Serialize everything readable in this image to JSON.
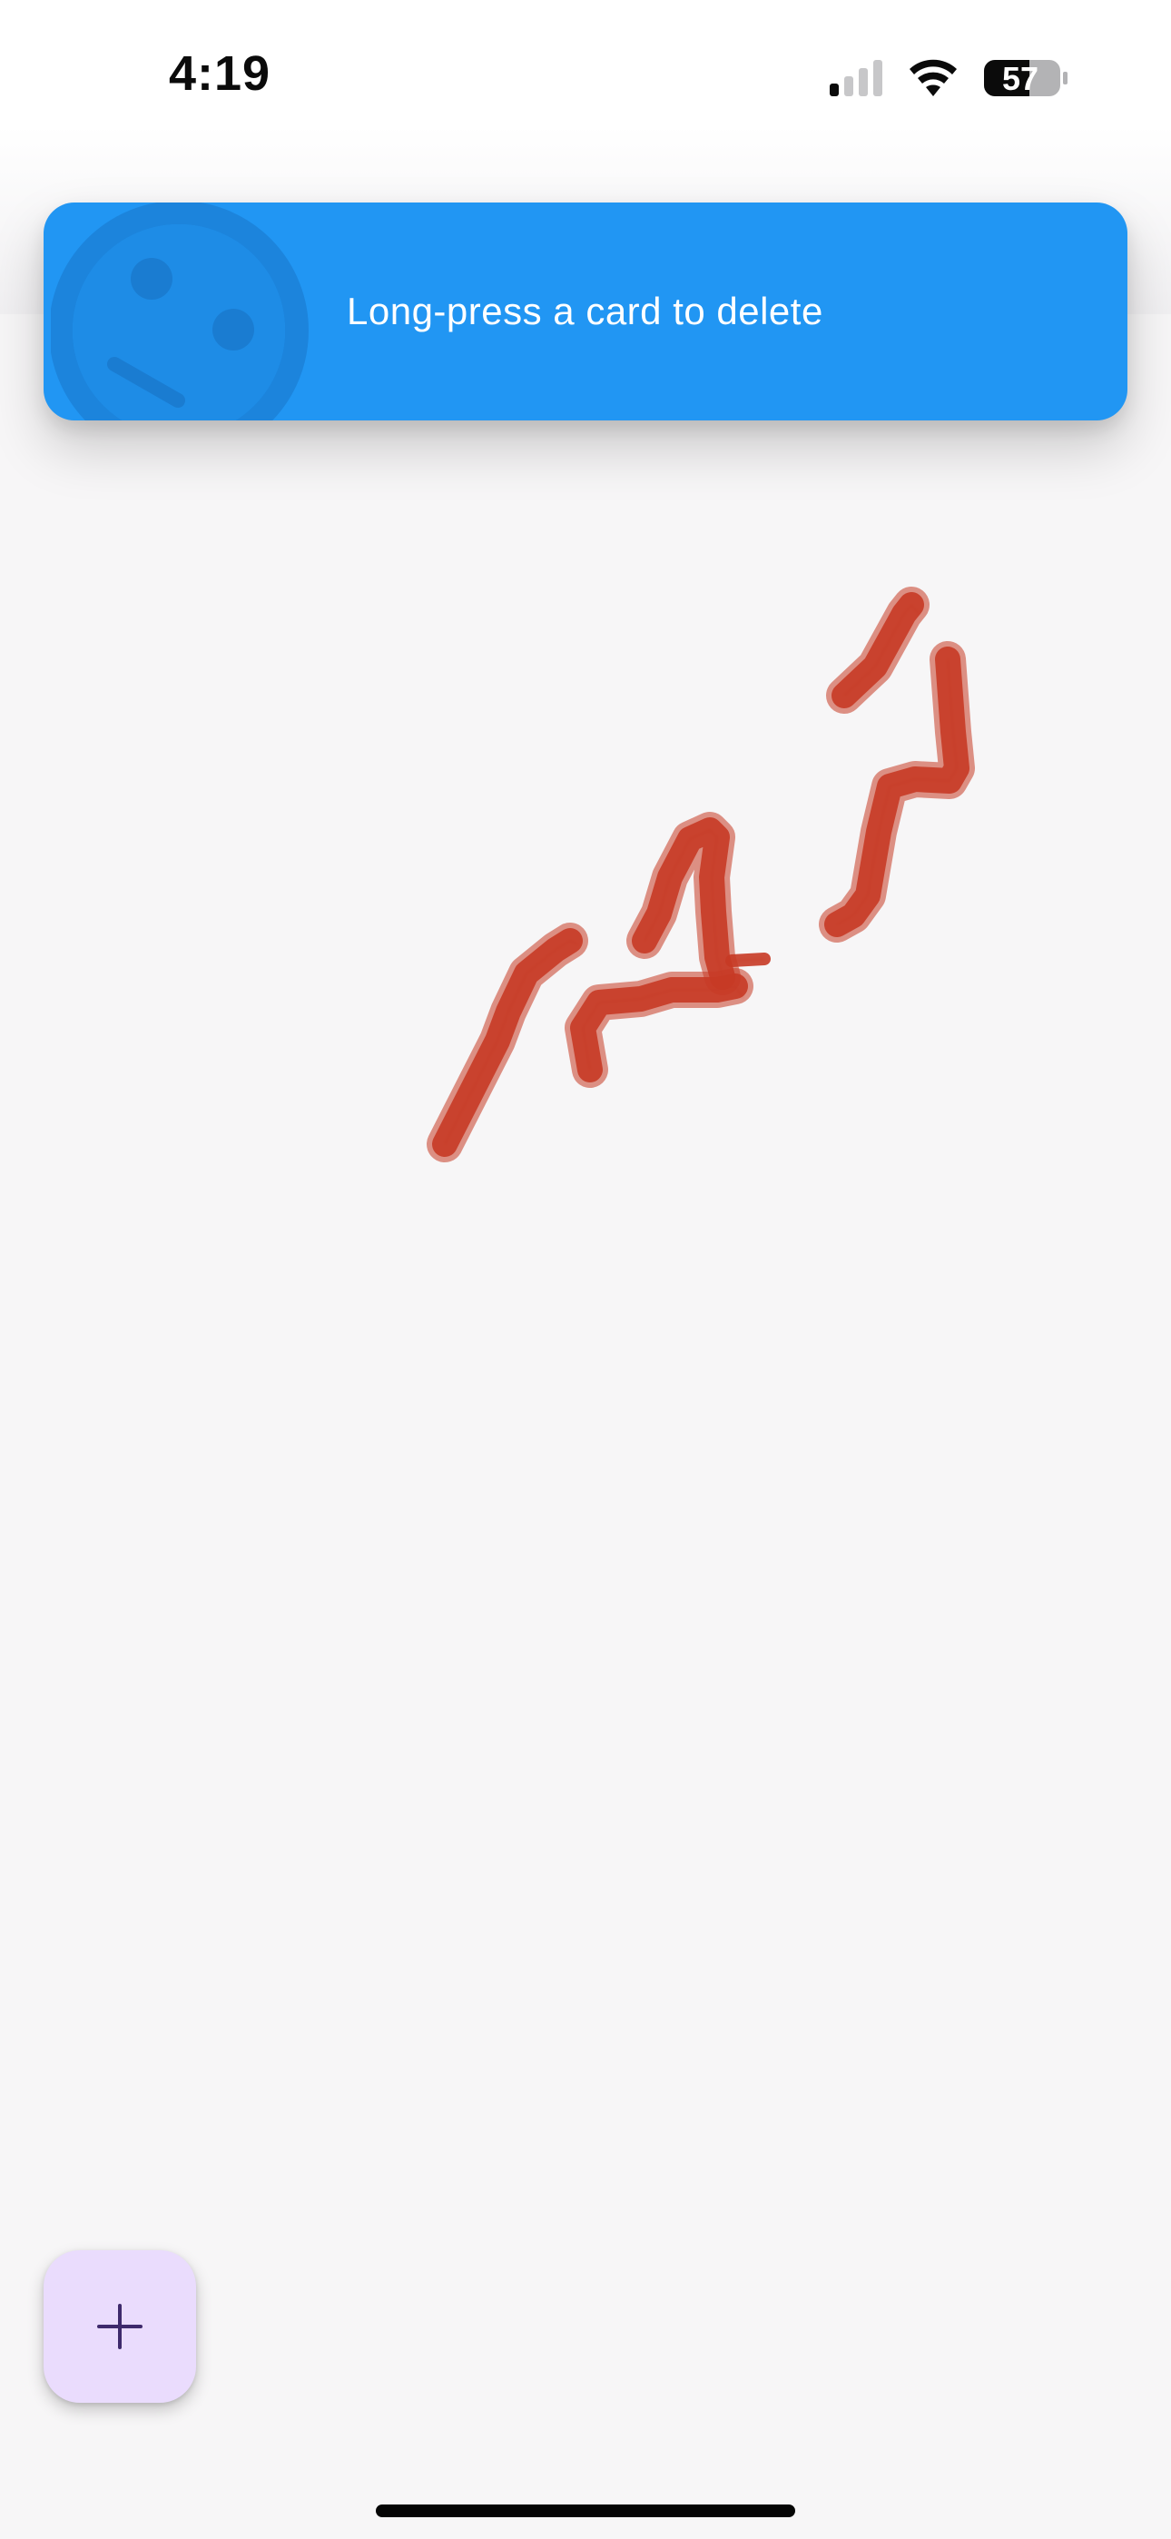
{
  "status_bar": {
    "time": "4:19",
    "battery_level": "57",
    "signal_icon": "cellular-signal-icon",
    "wifi_icon": "wifi-icon",
    "battery_icon": "battery-icon"
  },
  "banner": {
    "message": "Long-press a card to delete",
    "background_color": "#2196f3",
    "icon": "sad-face-icon"
  },
  "canvas": {
    "stroke_color": "#c63a25",
    "content": "red hand-drawn brush strokes"
  },
  "fab": {
    "icon": "add-icon",
    "background_color": "#eadcfd"
  }
}
